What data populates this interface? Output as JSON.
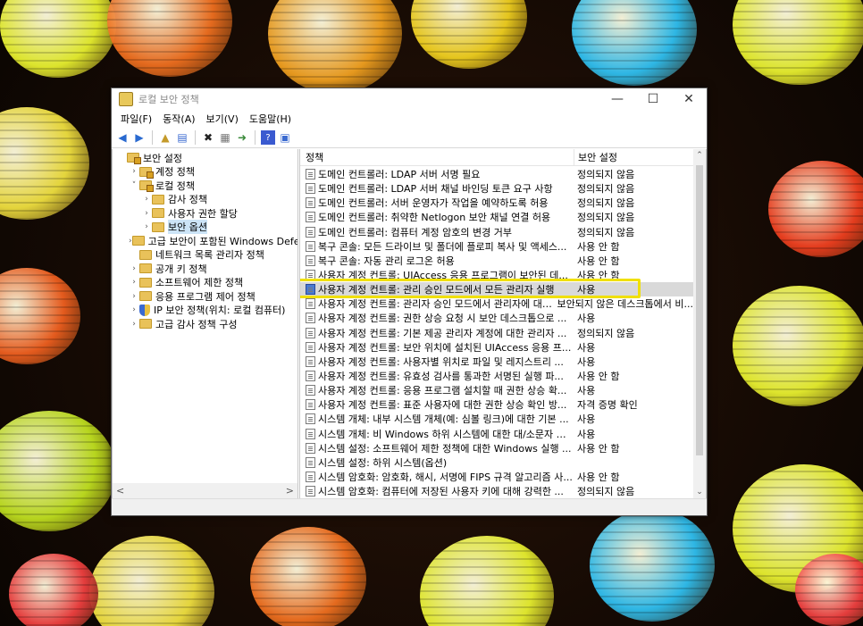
{
  "window": {
    "title": "로컬 보안 정책"
  },
  "menu": [
    "파일(F)",
    "동작(A)",
    "보기(V)",
    "도움말(H)"
  ],
  "toolbar": [
    "back-icon",
    "forward-icon",
    "up-folder-icon",
    "show-hide-tree-icon",
    "delete-icon",
    "properties-icon",
    "export-icon",
    "help-icon",
    "console-icon"
  ],
  "tree": [
    {
      "label": "보안 설정",
      "depth": 0,
      "chev": "",
      "icon": "folder-lock"
    },
    {
      "label": "계정 정책",
      "depth": 1,
      "chev": ">",
      "icon": "folder"
    },
    {
      "label": "로컬 정책",
      "depth": 1,
      "chev": "v",
      "icon": "folder"
    },
    {
      "label": "감사 정책",
      "depth": 2,
      "chev": ">",
      "icon": "folder"
    },
    {
      "label": "사용자 권한 할당",
      "depth": 2,
      "chev": ">",
      "icon": "folder"
    },
    {
      "label": "보안 옵션",
      "depth": 2,
      "chev": ">",
      "icon": "folder",
      "selected": true
    },
    {
      "label": "고급 보안이 포함된 Windows Defenc",
      "depth": 1,
      "chev": ">",
      "icon": "folder"
    },
    {
      "label": "네트워크 목록 관리자 정책",
      "depth": 1,
      "chev": "",
      "icon": "folder"
    },
    {
      "label": "공개 키 정책",
      "depth": 1,
      "chev": ">",
      "icon": "folder"
    },
    {
      "label": "소프트웨어 제한 정책",
      "depth": 1,
      "chev": ">",
      "icon": "folder"
    },
    {
      "label": "응용 프로그램 제어 정책",
      "depth": 1,
      "chev": ">",
      "icon": "folder"
    },
    {
      "label": "IP 보안 정책(위치: 로컬 컴퓨터)",
      "depth": 1,
      "chev": ">",
      "icon": "shield"
    },
    {
      "label": "고급 감사 정책 구성",
      "depth": 1,
      "chev": ">",
      "icon": "folder"
    }
  ],
  "list": {
    "col_policy": "정책",
    "col_setting": "보안 설정",
    "rows": [
      {
        "policy": "도메인 컨트롤러: LDAP 서버 서명 필요",
        "setting": "정의되지 않음"
      },
      {
        "policy": "도메인 컨트롤러: LDAP 서버 채널 바인딩 토큰 요구 사항",
        "setting": "정의되지 않음"
      },
      {
        "policy": "도메인 컨트롤러: 서버 운영자가 작업을 예약하도록 허용",
        "setting": "정의되지 않음"
      },
      {
        "policy": "도메인 컨트롤러: 취약한 Netlogon 보안 채널 연결 허용",
        "setting": "정의되지 않음"
      },
      {
        "policy": "도메인 컨트롤러: 컴퓨터 계정 암호의 변경 거부",
        "setting": "정의되지 않음"
      },
      {
        "policy": "복구 콘솔: 모든 드라이브 및 폴더에 플로피 복사 및 액세스...",
        "setting": "사용 안 함"
      },
      {
        "policy": "복구 콘솔: 자동 관리 로그온 허용",
        "setting": "사용 안 함"
      },
      {
        "policy": "사용자 계정 컨트롤: UIAccess 응용 프로그램이 보안된 데...",
        "setting": "사용 안 함"
      },
      {
        "policy": "사용자 계정 컨트롤: 관리 승인 모드에서 모든 관리자 실행",
        "setting": "사용",
        "highlight": true
      },
      {
        "policy": "사용자 계정 컨트롤: 관리자 승인 모드에서 관리자에 대한...",
        "setting": "보안되지 않은 데스크톱에서 비..."
      },
      {
        "policy": "사용자 계정 컨트롤: 권한 상승 요청 시 보안 데스크톱으로 ...",
        "setting": "사용"
      },
      {
        "policy": "사용자 계정 컨트롤: 기본 제공 관리자 계정에 대한 관리자 ...",
        "setting": "정의되지 않음"
      },
      {
        "policy": "사용자 계정 컨트롤: 보안 위치에 설치된 UIAccess 응용 프...",
        "setting": "사용"
      },
      {
        "policy": "사용자 계정 컨트롤: 사용자별 위치로 파일 및 레지스트리 ...",
        "setting": "사용"
      },
      {
        "policy": "사용자 계정 컨트롤: 유효성 검사를 통과한 서명된 실행 파...",
        "setting": "사용 안 함"
      },
      {
        "policy": "사용자 계정 컨트롤: 응용 프로그램 설치할 때 권한 상승 확...",
        "setting": "사용"
      },
      {
        "policy": "사용자 계정 컨트롤: 표준 사용자에 대한 권한 상승 확인 방...",
        "setting": "자격 증명 확인"
      },
      {
        "policy": "시스템 개체: 내부 시스템 개체(예: 심볼 링크)에 대한 기본 ...",
        "setting": "사용"
      },
      {
        "policy": "시스템 개체: 비 Windows 하위 시스템에 대한 대/소문자 구...",
        "setting": "사용"
      },
      {
        "policy": "시스템 설정: 소프트웨어 제한 정책에 대한 Windows 실행 ...",
        "setting": "사용 안 함"
      },
      {
        "policy": "시스템 설정: 하위 시스템(옵션)",
        "setting": ""
      },
      {
        "policy": "시스템 암호화: 암호화, 해시, 서명에 FIPS 규격 알고리즘 사...",
        "setting": "사용 안 함"
      },
      {
        "policy": "시스템 암호화: 컴퓨터에 저장된 사용자 키에 대해 강력한 ...",
        "setting": "정의되지 않음"
      }
    ]
  },
  "colors": {
    "highlight_border": "#f0e000",
    "selected_bg": "#cce4f7"
  }
}
